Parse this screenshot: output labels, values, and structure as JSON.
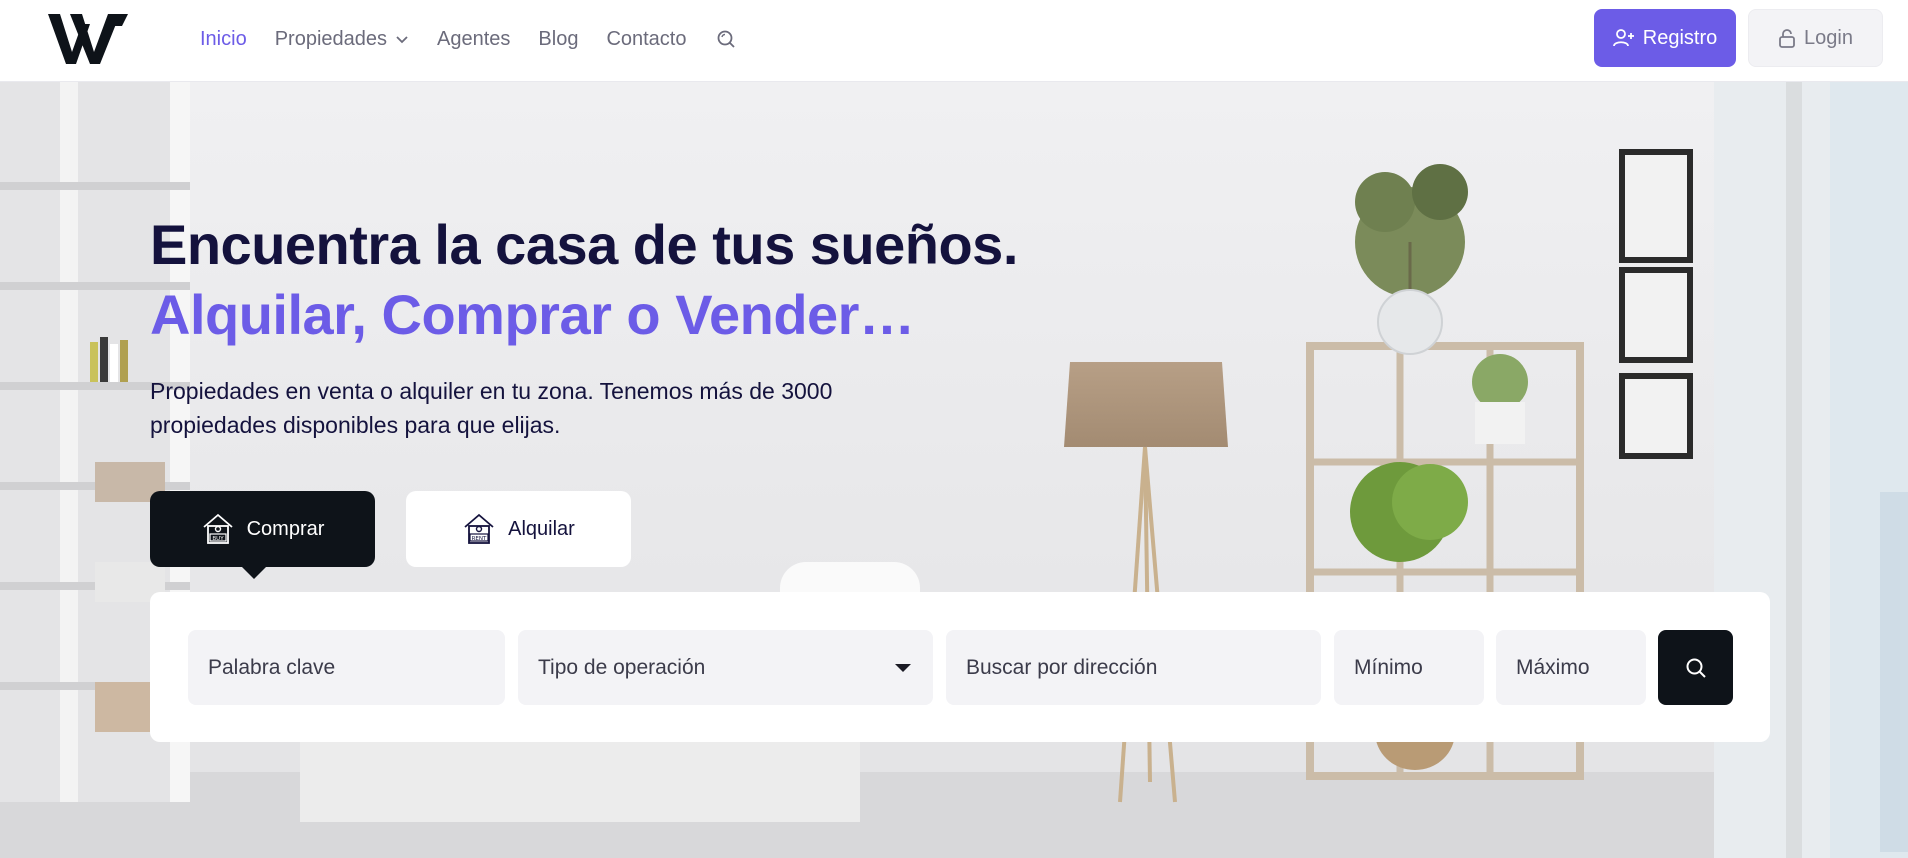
{
  "nav": {
    "items": [
      {
        "label": "Inicio",
        "active": true
      },
      {
        "label": "Propiedades",
        "dropdown": true
      },
      {
        "label": "Agentes"
      },
      {
        "label": "Blog"
      },
      {
        "label": "Contacto"
      }
    ],
    "search_icon": "search-icon"
  },
  "header": {
    "registro_label": "Registro",
    "login_label": "Login"
  },
  "hero": {
    "title": "Encuentra la casa de tus sueños.",
    "subtitle": "Alquilar, Comprar o Vender…",
    "description": "Propiedades en venta o alquiler en tu zona. Tenemos más de 3000 propiedades disponibles para que elijas."
  },
  "tabs": {
    "buy_label": "Comprar",
    "rent_label": "Alquilar",
    "buy_icon_text": "BUY",
    "rent_icon_text": "RENT"
  },
  "search": {
    "keyword_placeholder": "Palabra clave",
    "operation_placeholder": "Tipo de operación",
    "address_placeholder": "Buscar por dirección",
    "min_placeholder": "Mínimo",
    "max_placeholder": "Máximo"
  },
  "colors": {
    "accent": "#6c5ce7",
    "dark": "#0e1319",
    "title": "#14123d"
  }
}
